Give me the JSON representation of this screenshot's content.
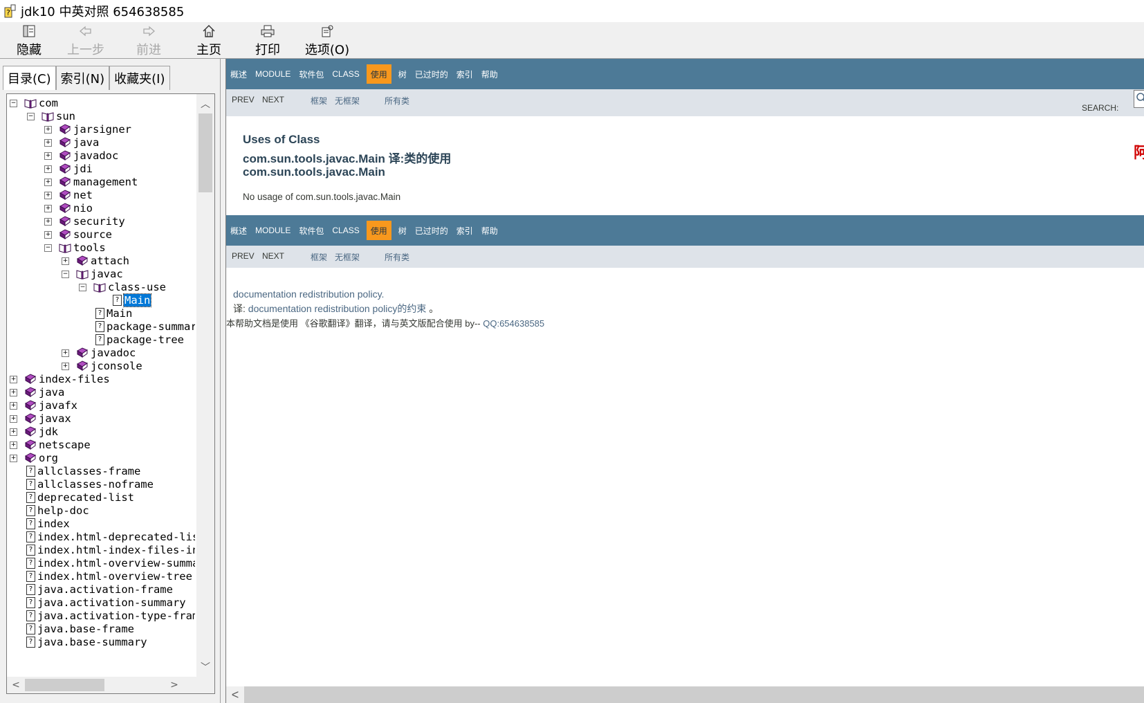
{
  "window": {
    "title": "jdk10 中英对照 654638585"
  },
  "toolbar": {
    "hide": "隐藏",
    "back": "上一步",
    "forward": "前进",
    "home": "主页",
    "print": "打印",
    "options": "选项(O)"
  },
  "tabs": [
    "目录(C)",
    "索引(N)",
    "收藏夹(I)"
  ],
  "tree": [
    {
      "label": "com",
      "depth": 0,
      "kind": "open",
      "toggle": "minus"
    },
    {
      "label": "sun",
      "depth": 1,
      "kind": "open",
      "toggle": "minus"
    },
    {
      "label": "jarsigner",
      "depth": 2,
      "kind": "book",
      "toggle": "plus"
    },
    {
      "label": "java",
      "depth": 2,
      "kind": "book",
      "toggle": "plus"
    },
    {
      "label": "javadoc",
      "depth": 2,
      "kind": "book",
      "toggle": "plus"
    },
    {
      "label": "jdi",
      "depth": 2,
      "kind": "book",
      "toggle": "plus"
    },
    {
      "label": "management",
      "depth": 2,
      "kind": "book",
      "toggle": "plus"
    },
    {
      "label": "net",
      "depth": 2,
      "kind": "book",
      "toggle": "plus"
    },
    {
      "label": "nio",
      "depth": 2,
      "kind": "book",
      "toggle": "plus"
    },
    {
      "label": "security",
      "depth": 2,
      "kind": "book",
      "toggle": "plus"
    },
    {
      "label": "source",
      "depth": 2,
      "kind": "book",
      "toggle": "plus"
    },
    {
      "label": "tools",
      "depth": 2,
      "kind": "open",
      "toggle": "minus"
    },
    {
      "label": "attach",
      "depth": 3,
      "kind": "book",
      "toggle": "plus"
    },
    {
      "label": "javac",
      "depth": 3,
      "kind": "open",
      "toggle": "minus"
    },
    {
      "label": "class-use",
      "depth": 4,
      "kind": "open",
      "toggle": "minus"
    },
    {
      "label": "Main",
      "depth": 5,
      "kind": "doc",
      "toggle": "none",
      "selected": true
    },
    {
      "label": "Main",
      "depth": 4,
      "kind": "doc",
      "toggle": "none"
    },
    {
      "label": "package-summary",
      "depth": 4,
      "kind": "doc",
      "toggle": "none"
    },
    {
      "label": "package-tree",
      "depth": 4,
      "kind": "doc",
      "toggle": "none"
    },
    {
      "label": "javadoc",
      "depth": 3,
      "kind": "book",
      "toggle": "plus"
    },
    {
      "label": "jconsole",
      "depth": 3,
      "kind": "book",
      "toggle": "plus"
    },
    {
      "label": "index-files",
      "depth": 0,
      "kind": "book",
      "toggle": "plus"
    },
    {
      "label": "java",
      "depth": 0,
      "kind": "book",
      "toggle": "plus"
    },
    {
      "label": "javafx",
      "depth": 0,
      "kind": "book",
      "toggle": "plus"
    },
    {
      "label": "javax",
      "depth": 0,
      "kind": "book",
      "toggle": "plus"
    },
    {
      "label": "jdk",
      "depth": 0,
      "kind": "book",
      "toggle": "plus"
    },
    {
      "label": "netscape",
      "depth": 0,
      "kind": "book",
      "toggle": "plus"
    },
    {
      "label": "org",
      "depth": 0,
      "kind": "book",
      "toggle": "plus"
    },
    {
      "label": "allclasses-frame",
      "depth": 0,
      "kind": "doc",
      "toggle": "none"
    },
    {
      "label": "allclasses-noframe",
      "depth": 0,
      "kind": "doc",
      "toggle": "none"
    },
    {
      "label": "deprecated-list",
      "depth": 0,
      "kind": "doc",
      "toggle": "none"
    },
    {
      "label": "help-doc",
      "depth": 0,
      "kind": "doc",
      "toggle": "none"
    },
    {
      "label": "index",
      "depth": 0,
      "kind": "doc",
      "toggle": "none"
    },
    {
      "label": "index.html-deprecated-list",
      "depth": 0,
      "kind": "doc",
      "toggle": "none"
    },
    {
      "label": "index.html-index-files-index",
      "depth": 0,
      "kind": "doc",
      "toggle": "none"
    },
    {
      "label": "index.html-overview-summary",
      "depth": 0,
      "kind": "doc",
      "toggle": "none"
    },
    {
      "label": "index.html-overview-tree",
      "depth": 0,
      "kind": "doc",
      "toggle": "none"
    },
    {
      "label": "java.activation-frame",
      "depth": 0,
      "kind": "doc",
      "toggle": "none"
    },
    {
      "label": "java.activation-summary",
      "depth": 0,
      "kind": "doc",
      "toggle": "none"
    },
    {
      "label": "java.activation-type-frame",
      "depth": 0,
      "kind": "doc",
      "toggle": "none"
    },
    {
      "label": "java.base-frame",
      "depth": 0,
      "kind": "doc",
      "toggle": "none"
    },
    {
      "label": "java.base-summary",
      "depth": 0,
      "kind": "doc",
      "toggle": "none"
    }
  ],
  "navbar": {
    "items": [
      "概述",
      "MODULE",
      "软件包",
      "CLASS",
      "使用",
      "树",
      "已过时的",
      "索引",
      "帮助"
    ],
    "active_index": 4
  },
  "subnav": {
    "prev": "PREV",
    "next": "NEXT",
    "frames": "框架",
    "noframes": "无框架",
    "allclasses": "所有类",
    "search_label": "SEARCH:"
  },
  "content": {
    "title_line1": "Uses of Class",
    "title_line2": "com.sun.tools.javac.Main 译:类的使用",
    "title_line3": "com.sun.tools.javac.Main",
    "no_usage": "No usage of com.sun.tools.javac.Main",
    "red_char": "阿",
    "footer_link1": "documentation redistribution policy.",
    "footer_prefix2": "译: ",
    "footer_link2": "documentation redistribution policy的约束",
    "footer_suffix2": "。",
    "footer_text3": "本帮助文档是使用 《谷歌翻译》翻译，请与英文版配合使用 by-- ",
    "footer_qq": "QQ:654638585"
  },
  "colors": {
    "navbar_bg": "#4d7a97",
    "navbar_active": "#f8981d",
    "subnav_bg": "#dee3e9",
    "link": "#4a6782",
    "selected_bg": "#0078d7"
  }
}
